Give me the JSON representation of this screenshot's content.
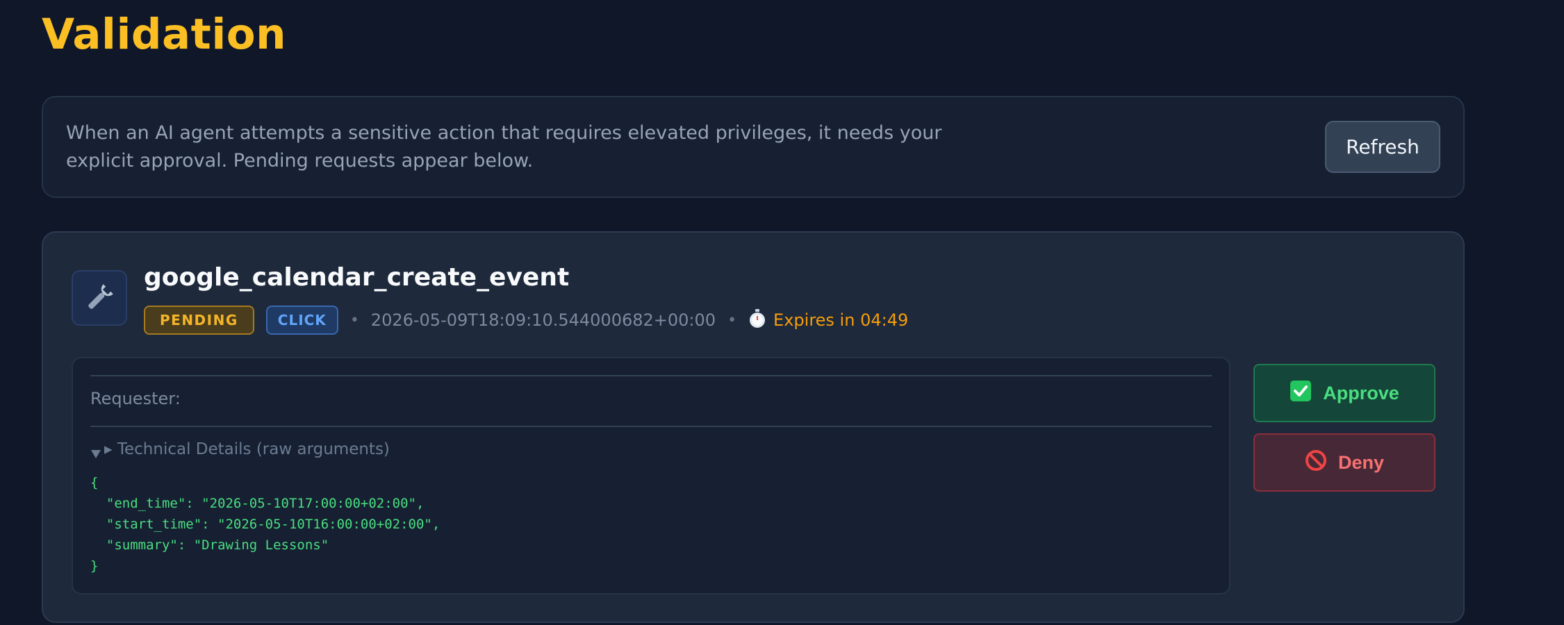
{
  "page": {
    "title": "Validation"
  },
  "info": {
    "text": "When an AI agent attempts a sensitive action that requires elevated privileges, it needs your explicit approval. Pending requests appear below.",
    "refresh_label": "Refresh"
  },
  "request": {
    "icon": "wrench-icon",
    "tool_name": "google_calendar_create_event",
    "status_badge": "PENDING",
    "type_badge": "CLICK",
    "separator": "•",
    "timestamp": "2026-05-09T18:09:10.544000682+00:00",
    "timer_icon": "stopwatch-icon",
    "expires_text": "Expires in 04:49",
    "requester_label": "Requester:",
    "details_summary": "▸ Technical Details (raw arguments)",
    "raw_arguments": "{\n  \"end_time\": \"2026-05-10T17:00:00+02:00\",\n  \"start_time\": \"2026-05-10T16:00:00+02:00\",\n  \"summary\": \"Drawing Lessons\"\n}",
    "approve_label": "Approve",
    "deny_label": "Deny"
  },
  "colors": {
    "background": "#0f1729",
    "title_accent": "#fbbf24",
    "pending": "#f5b52a",
    "click": "#60a5fa",
    "approve": "#4ade80",
    "deny": "#f87171"
  }
}
